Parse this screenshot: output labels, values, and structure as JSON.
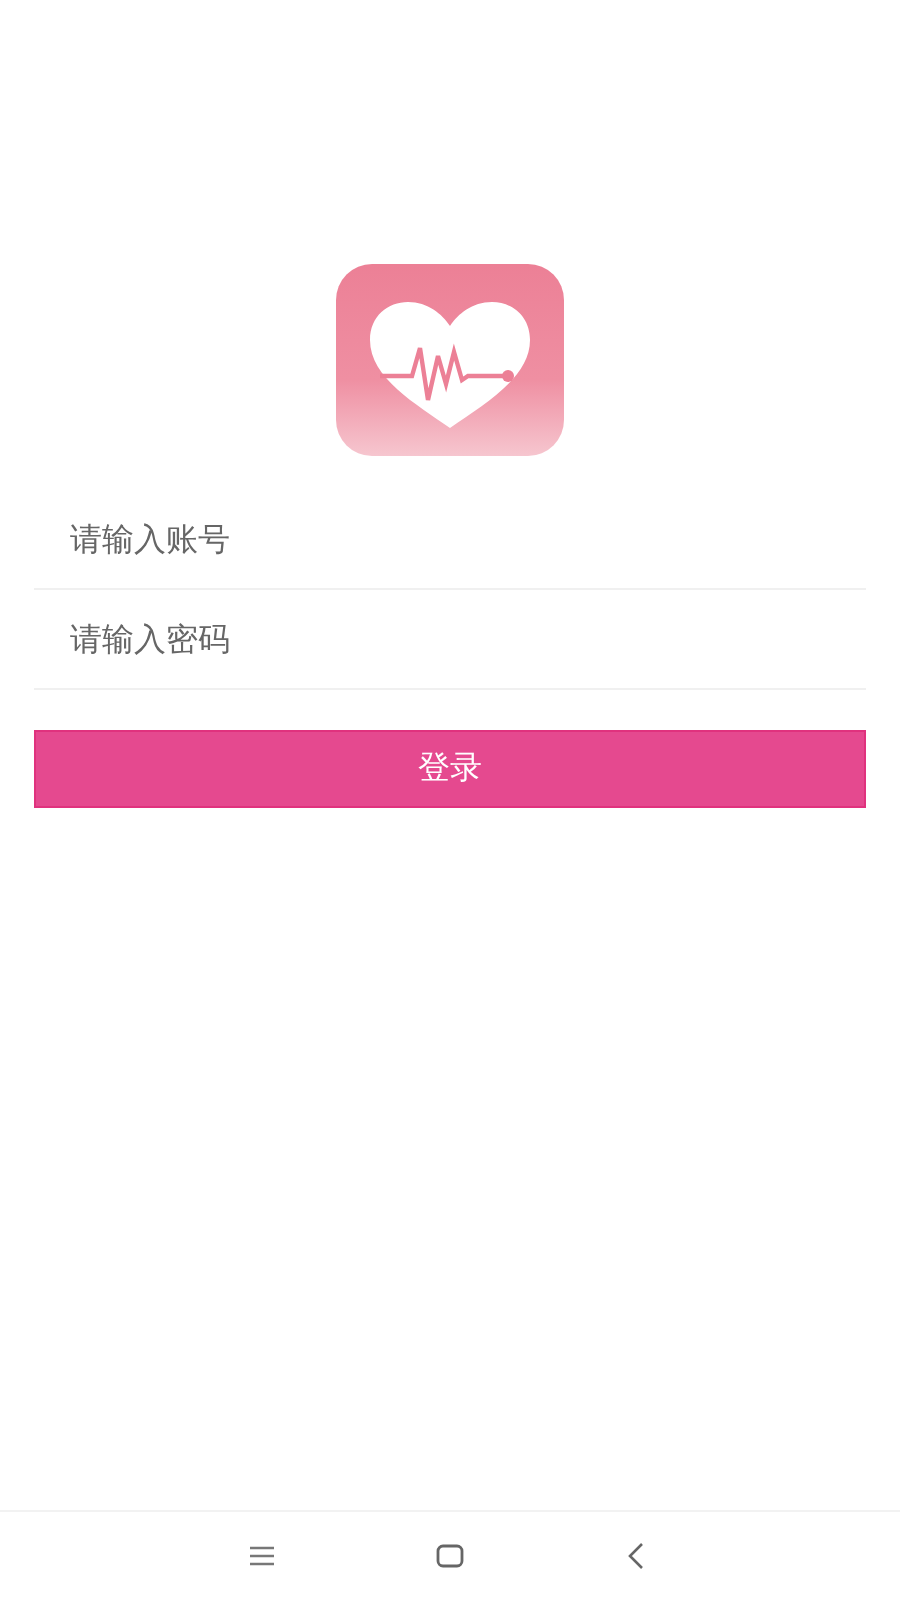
{
  "login_form": {
    "fields": [
      {
        "placeholder": "请输入账号"
      },
      {
        "placeholder": "请输入密码"
      }
    ],
    "submit": "登录"
  }
}
